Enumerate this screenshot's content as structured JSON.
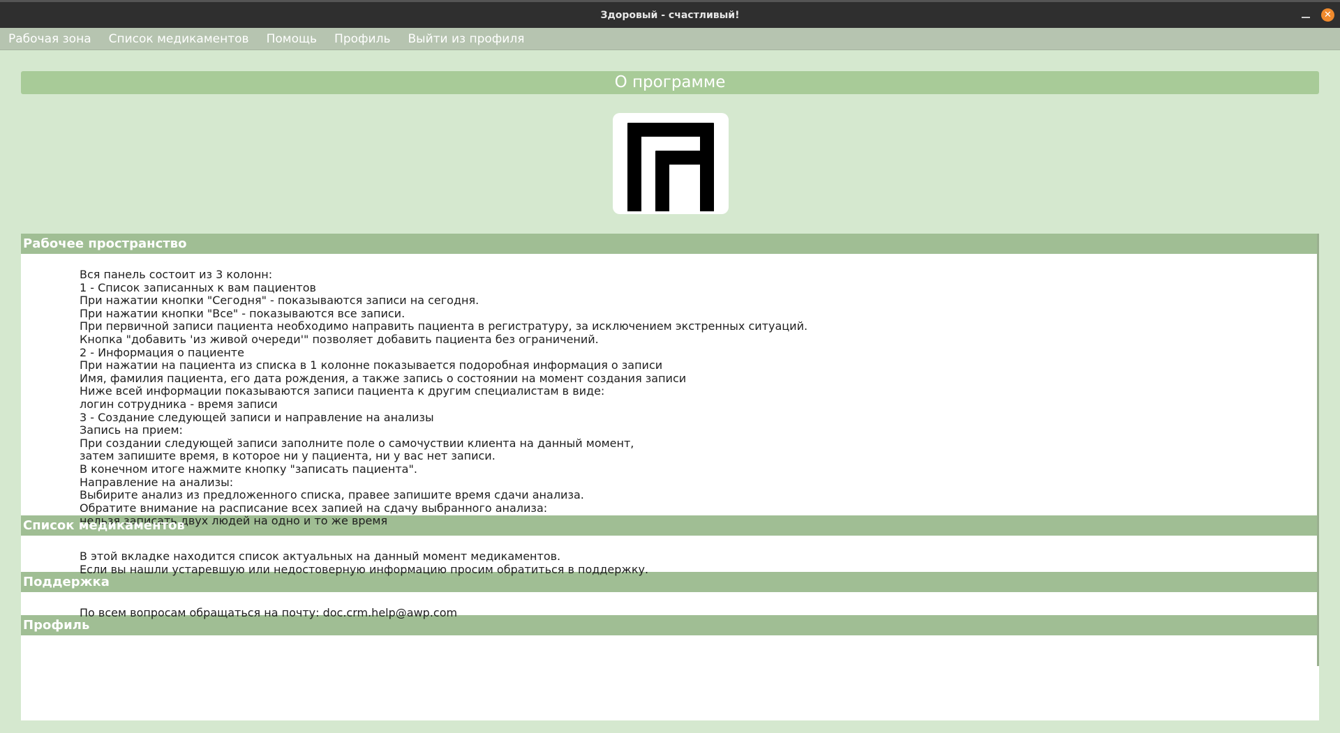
{
  "window": {
    "title": "Здоровый - счастливый!"
  },
  "menu": [
    {
      "label": "Рабочая зона"
    },
    {
      "label": "Список медикаментов"
    },
    {
      "label": "Помощь"
    },
    {
      "label": "Профиль"
    },
    {
      "label": "Выйти из профиля"
    }
  ],
  "about": {
    "title": "О программе",
    "logo_icon": "logo-icon"
  },
  "sections": [
    {
      "title": "Рабочее пространство",
      "lines": [
        "Вся панель состоит из 3 колонн:",
        "1 - Список записанных к вам пациентов",
        "При нажатии кнопки \"Сегодня\" - показываются записи на сегодня.",
        "При нажатии кнопки \"Все\" - показываются все записи.",
        "При первичной записи пациента необходимо направить пациента в регистратуру, за исключением экстренных ситуаций.",
        "Кнопка \"добавить 'из живой очереди'\" позволяет добавить пациента без ограничений.",
        "2 - Информация о пациенте",
        "При нажатии на пациента из списка в 1 колонне показывается подоробная информация о записи",
        "Имя, фамилия пациента, его дата рождения, а также запись о состоянии на момент создания записи",
        "Ниже всей информации показываются записи пациента к другим специалистам в виде:",
        "логин сотрудника - время записи",
        "3 - Создание следующей записи и направление на анализы",
        "Запись на прием:",
        "При создании следующей записи заполните поле о самочуствии клиента на данный момент,",
        "затем запишите время, в которое ни у пациента, ни у вас нет записи.",
        "В конечном итоге нажмите кнопку \"записать пациента\".",
        "Направление на анализы:",
        "Выбирите анализ из предложенного списка, правее запишите время сдачи анализа.",
        "Обратите внимание на расписание всех запией на сдачу выбранного анализа:",
        "нельзя записать двух людей на одно и то же время"
      ]
    },
    {
      "title": "Список медикаментов",
      "lines": [
        "В этой вкладке находится список актуальных на данный момент медикаментов.",
        "Если вы нашли устаревшую или недостоверную информацию просим обратиться в поддержку."
      ]
    },
    {
      "title": "Поддержка",
      "lines": [
        "По всем вопросам обращаться на почту: doc.crm.help@awp.com"
      ]
    },
    {
      "title": "Профиль",
      "lines": []
    }
  ],
  "colors": {
    "background": "#d5e8cf",
    "menubar": "#b6c4b0",
    "header_green": "#a8cb98",
    "section_green": "#a0be94",
    "close_button": "#f08a2d"
  }
}
